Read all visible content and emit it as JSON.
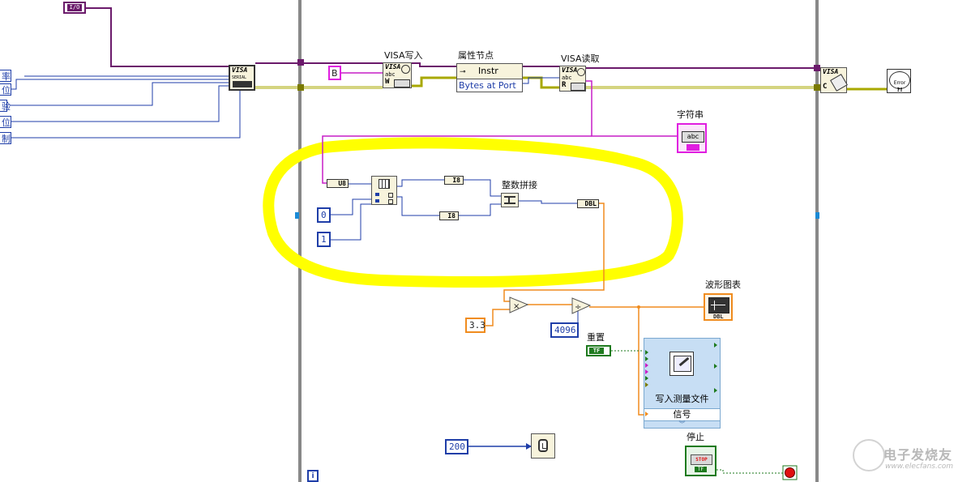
{
  "diagram": {
    "io_constant": "I/O",
    "left_cut_labels": [
      "率",
      "位",
      "验",
      "位",
      "制"
    ],
    "visa_serial": {
      "line1": "VISA",
      "line2": "SERIAL"
    },
    "constant_b": "B",
    "visa_write": {
      "label": "VISA写入",
      "icon_top": "VISA",
      "icon_mid": "abc",
      "icon_letter": "W"
    },
    "property_node": {
      "label": "属性节点",
      "class": "Instr",
      "property": "Bytes at Port"
    },
    "visa_read": {
      "label": "VISA读取",
      "icon_top": "VISA",
      "icon_mid": "abc",
      "icon_letter": "R"
    },
    "visa_close": {
      "icon_top": "VISA",
      "icon_letter": "C"
    },
    "error_handler": {
      "text": "Error"
    },
    "string_indicator": {
      "label": "字符串",
      "text": "abc"
    },
    "u8_conversion": "U8",
    "const_0": "0",
    "const_1": "1",
    "i8_top": "I8",
    "i8_bottom": "I8",
    "join_numbers": {
      "label": "整数拼接"
    },
    "dbl_conversion": "DBL",
    "const_33": "3.3",
    "const_4096": "4096",
    "waveform_chart": {
      "label": "波形图表",
      "type": "DBL"
    },
    "reset": {
      "label": "重置",
      "value": "TF"
    },
    "write_measurement": {
      "title": "写入测量文件",
      "terminal": "信号"
    },
    "const_200": "200",
    "stop": {
      "label": "停止",
      "text": "STOP",
      "type": "TF"
    },
    "info_box": "i",
    "watermark": {
      "line1": "电子发烧友",
      "line2": "www.elecfans.com"
    }
  },
  "colors": {
    "highlight": "#ffff00",
    "wire_integer": "#1f3ea8",
    "wire_float": "#f08c1e",
    "wire_string": "#c71ec7",
    "wire_refnum": "#6b1a6b",
    "wire_error": "#a8a800",
    "wire_boolean": "#1e7a1e",
    "frame": "#888888"
  }
}
